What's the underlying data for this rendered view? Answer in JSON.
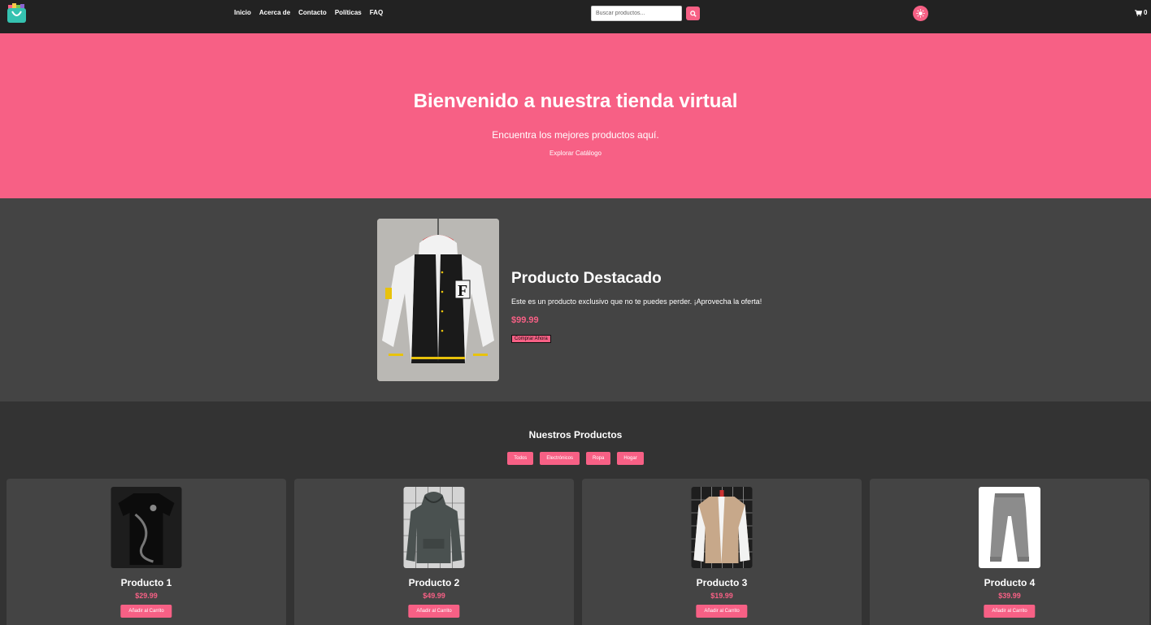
{
  "colors": {
    "accent": "#f76085",
    "navbar": "#222222",
    "featured_bg": "#444444",
    "body_bg": "#333333"
  },
  "nav": {
    "logo_icon": "shopping-bag-logo",
    "links": [
      "Inicio",
      "Acerca de",
      "Contacto",
      "Políticas",
      "FAQ"
    ],
    "search_placeholder": "Buscar productos...",
    "search_icon": "search-icon",
    "theme_icon": "sun-icon",
    "cart_icon": "cart-icon",
    "cart_count": "0"
  },
  "hero": {
    "title": "Bienvenido a nuestra tienda virtual",
    "subtitle": "Encuentra los mejores productos aquí.",
    "cta": "Explorar Catálogo"
  },
  "featured": {
    "title": "Producto Destacado",
    "description": "Este es un producto exclusivo que no te puedes perder. ¡Aprovecha la oferta!",
    "price": "$99.99",
    "button": "Comprar Ahora"
  },
  "products": {
    "heading": "Nuestros Productos",
    "filters": [
      "Todos",
      "Electrónicos",
      "Ropa",
      "Hogar"
    ],
    "items": [
      {
        "name": "Producto 1",
        "price": "$29.99",
        "button": "Añadir al Carrito"
      },
      {
        "name": "Producto 2",
        "price": "$49.99",
        "button": "Añadir al Carrito"
      },
      {
        "name": "Producto 3",
        "price": "$19.99",
        "button": "Añadir al Carrito"
      },
      {
        "name": "Producto 4",
        "price": "$39.99",
        "button": "Añadir al Carrito"
      }
    ]
  }
}
